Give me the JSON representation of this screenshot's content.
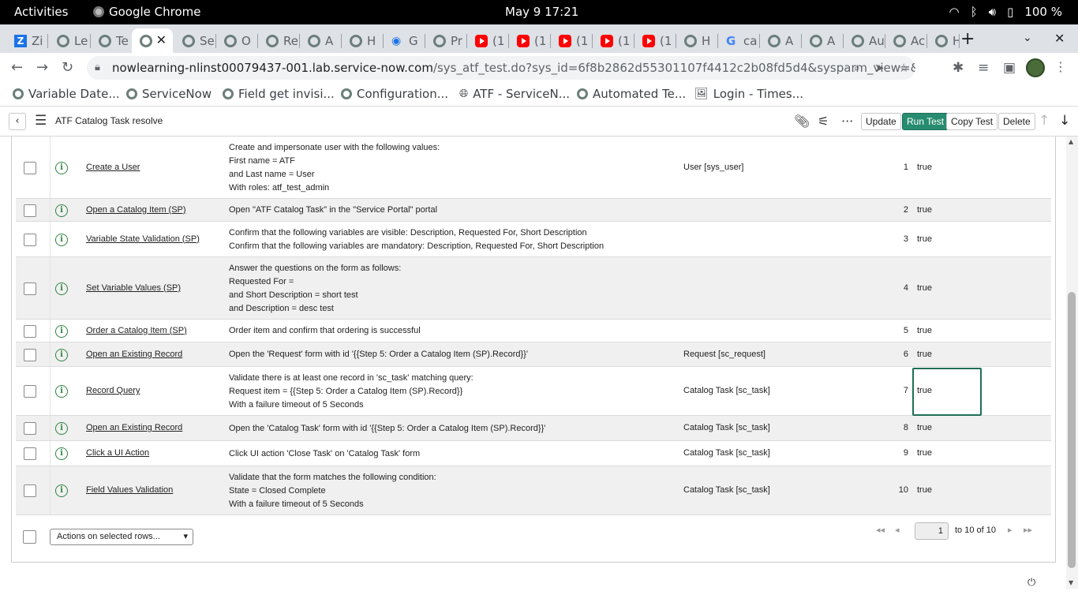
{
  "os": {
    "activities": "Activities",
    "app_name": "Google Chrome",
    "clock": "May 9  17:21",
    "battery": "100 %"
  },
  "browser": {
    "tabs": [
      {
        "label": "Zi",
        "icon": "z"
      },
      {
        "label": "Le",
        "icon": "sn"
      },
      {
        "label": "Te",
        "icon": "sn"
      },
      {
        "label": "",
        "icon": "sn",
        "active": true
      },
      {
        "label": "Se",
        "icon": "sn"
      },
      {
        "label": "O",
        "icon": "sn"
      },
      {
        "label": "Re",
        "icon": "sn"
      },
      {
        "label": "A",
        "icon": "sn"
      },
      {
        "label": "H",
        "icon": "sn"
      },
      {
        "label": "G",
        "icon": "wifi"
      },
      {
        "label": "Pr",
        "icon": "sn"
      },
      {
        "label": "(1",
        "icon": "yt"
      },
      {
        "label": "(1",
        "icon": "yt"
      },
      {
        "label": "(1",
        "icon": "yt"
      },
      {
        "label": "(1",
        "icon": "yt"
      },
      {
        "label": "(1",
        "icon": "yt"
      },
      {
        "label": "H",
        "icon": "sn"
      },
      {
        "label": "ca",
        "icon": "g"
      },
      {
        "label": "A",
        "icon": "sn"
      },
      {
        "label": "A",
        "icon": "sn"
      },
      {
        "label": "Au",
        "icon": "sn"
      },
      {
        "label": "Ac",
        "icon": "sn"
      },
      {
        "label": "H",
        "icon": "sn"
      }
    ],
    "url_host": "nowlearning-nlinst00079437-001.lab.service-now.com",
    "url_path": "/sys_atf_test.do?sys_id=6f8b2862d55301107f4412c2b08fd5d4&sysparm_view=&sysparm_dom...",
    "bookmarks": [
      {
        "label": "Variable Date...",
        "icon": "sn"
      },
      {
        "label": "ServiceNow",
        "icon": "sn"
      },
      {
        "label": "Field get invisi...",
        "icon": "sn"
      },
      {
        "label": "Configuration...",
        "icon": "sn"
      },
      {
        "label": "ATF - ServiceN...",
        "icon": "globe"
      },
      {
        "label": "Automated Te...",
        "icon": "sn"
      },
      {
        "label": "Login - Times...",
        "icon": "img"
      }
    ]
  },
  "header": {
    "title": "ATF Catalog Task resolve",
    "update_label": "Update",
    "run_label": "Run Test",
    "copy_label": "Copy Test",
    "delete_label": "Delete"
  },
  "steps": [
    {
      "name": "Create a User",
      "desc": [
        "Create and impersonate user with the following values:",
        "First name = ATF",
        "and Last name = User",
        "With roles: atf_test_admin"
      ],
      "table": "User [sys_user]",
      "order": "1",
      "active": "true"
    },
    {
      "name": "Open a Catalog Item (SP)",
      "desc": [
        "Open \"ATF Catalog Task\" in the \"Service Portal\" portal"
      ],
      "table": "",
      "order": "2",
      "active": "true"
    },
    {
      "name": "Variable State Validation (SP)",
      "desc": [
        "Confirm that the following variables are visible: Description, Requested For, Short Description",
        "Confirm that the following variables are mandatory: Description, Requested For, Short Description"
      ],
      "table": "",
      "order": "3",
      "active": "true"
    },
    {
      "name": "Set Variable Values (SP)",
      "desc": [
        "Answer the questions on the form as follows:",
        "Requested For =",
        "and Short Description = short test",
        "and Description = desc test"
      ],
      "table": "",
      "order": "4",
      "active": "true"
    },
    {
      "name": "Order a Catalog Item (SP)",
      "desc": [
        "Order item and confirm that ordering is successful"
      ],
      "table": "",
      "order": "5",
      "active": "true"
    },
    {
      "name": "Open an Existing Record",
      "desc": [
        "Open the 'Request' form with id '{{Step 5: Order a Catalog Item (SP).Record}}'"
      ],
      "table": "Request [sc_request]",
      "order": "6",
      "active": "true"
    },
    {
      "name": "Record Query",
      "desc": [
        "Validate there is at least one record in 'sc_task' matching query:",
        "Request item = {{Step 5: Order a Catalog Item (SP).Record}}",
        "With a failure timeout of 5 Seconds"
      ],
      "table": "Catalog Task [sc_task]",
      "order": "7",
      "active": "true"
    },
    {
      "name": "Open an Existing Record",
      "desc": [
        "Open the 'Catalog Task' form with id '{{Step 5: Order a Catalog Item (SP).Record}}'"
      ],
      "table": "Catalog Task [sc_task]",
      "order": "8",
      "active": "true"
    },
    {
      "name": "Click a UI Action",
      "desc": [
        "Click UI action 'Close Task' on 'Catalog Task' form"
      ],
      "table": "Catalog Task [sc_task]",
      "order": "9",
      "active": "true"
    },
    {
      "name": "Field Values Validation",
      "desc": [
        "Validate that the form matches the following condition:",
        "State = Closed Complete",
        "With a failure timeout of 5 Seconds"
      ],
      "table": "Catalog Task [sc_task]",
      "order": "10",
      "active": "true"
    }
  ],
  "footer": {
    "actions_select": "Actions on selected rows...",
    "page_input": "1",
    "page_count": "to 10 of 10"
  },
  "colors": {
    "primary_button": "#278c6f",
    "info_icon": "#2e8540"
  }
}
